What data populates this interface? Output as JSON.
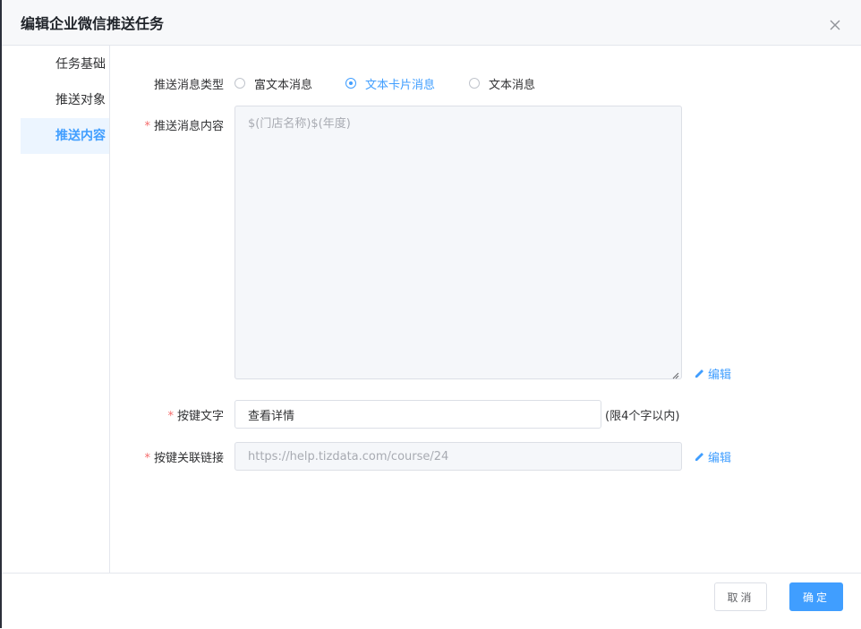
{
  "dialog": {
    "title": "编辑企业微信推送任务"
  },
  "sidebar": {
    "items": [
      {
        "label": "任务基础"
      },
      {
        "label": "推送对象"
      },
      {
        "label": "推送内容",
        "active": true
      }
    ]
  },
  "form": {
    "message_type": {
      "label": "推送消息类型",
      "options": [
        "富文本消息",
        "文本卡片消息",
        "文本消息"
      ],
      "selected": "文本卡片消息"
    },
    "content": {
      "required_mark": "*",
      "label": "推送消息内容",
      "placeholder": "$(门店名称)$(年度)",
      "edit_label": "编辑"
    },
    "button_text": {
      "required_mark": "*",
      "label": "按键文字",
      "value": "查看详情",
      "hint": "(限4个字以内)"
    },
    "button_link": {
      "required_mark": "*",
      "label": "按键关联链接",
      "placeholder": "https://help.tizdata.com/course/24",
      "edit_label": "编辑"
    }
  },
  "footer": {
    "cancel_label": "取消",
    "ok_label": "确定"
  },
  "colors": {
    "accent": "#409eff",
    "required": "#f56c6c"
  },
  "icons": [
    "close-icon",
    "pencil-icon",
    "resize-handle-icon"
  ]
}
